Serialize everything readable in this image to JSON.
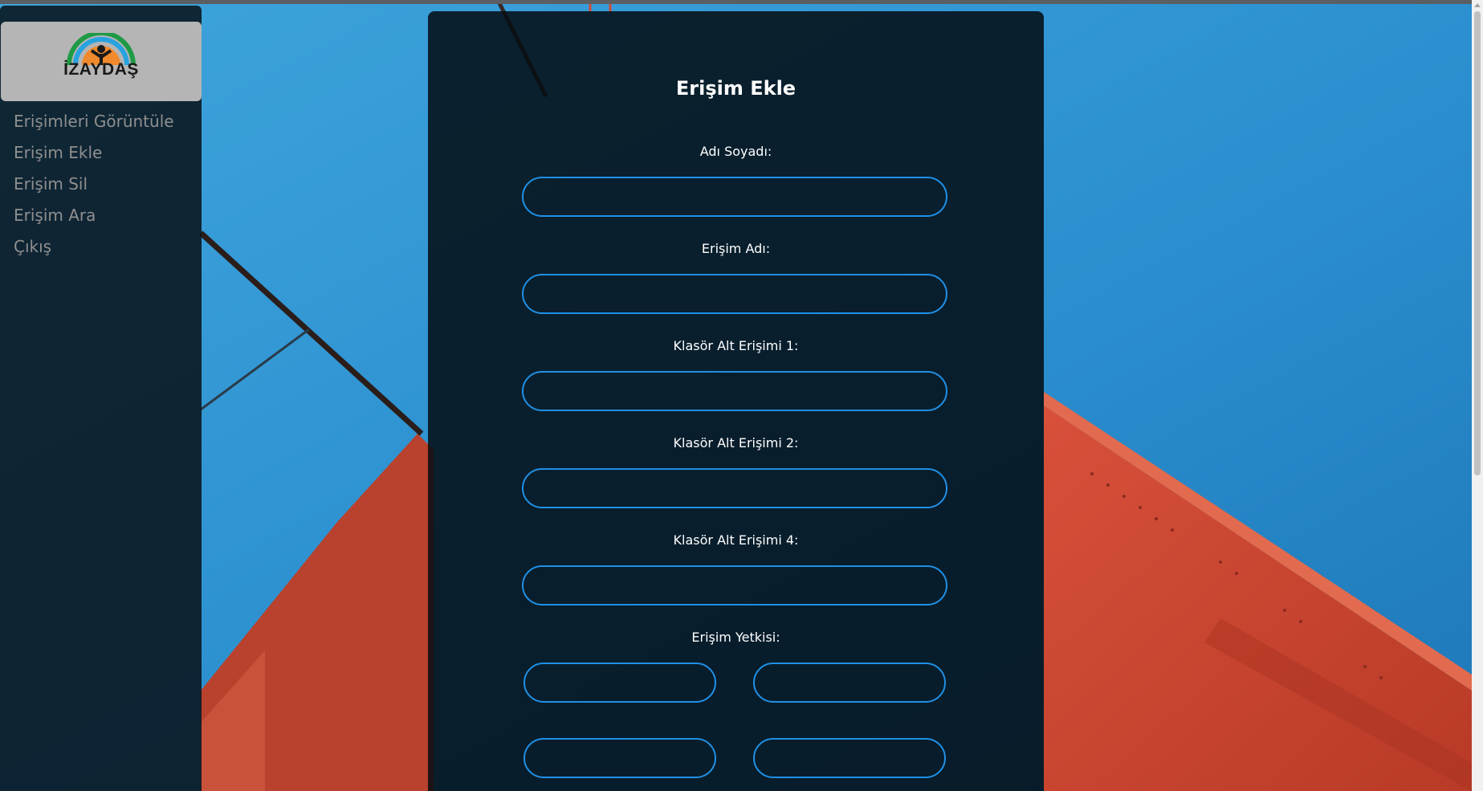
{
  "sidebar": {
    "logo_text": "İZAYDAŞ",
    "items": [
      {
        "label": "Erişimleri Görüntüle"
      },
      {
        "label": "Erişim Ekle"
      },
      {
        "label": "Erişim Sil"
      },
      {
        "label": "Erişim Ara"
      },
      {
        "label": "Çıkış"
      }
    ]
  },
  "form": {
    "title": "Erişim Ekle",
    "fields": [
      {
        "label": "Adı Soyadı:",
        "value": ""
      },
      {
        "label": "Erişim Adı:",
        "value": ""
      },
      {
        "label": "Klasör Alt Erişimi 1:",
        "value": ""
      },
      {
        "label": "Klasör Alt Erişimi 2:",
        "value": ""
      },
      {
        "label": "Klasör Alt Erişimi 4:",
        "value": ""
      }
    ],
    "permission_label": "Erişim Yetkisi:",
    "permission_fields": [
      {
        "value": ""
      },
      {
        "value": ""
      },
      {
        "value": ""
      },
      {
        "value": ""
      }
    ]
  },
  "colors": {
    "accent": "#1f90e6",
    "sky": "#2a8ed0",
    "bridge": "#c8432e"
  }
}
